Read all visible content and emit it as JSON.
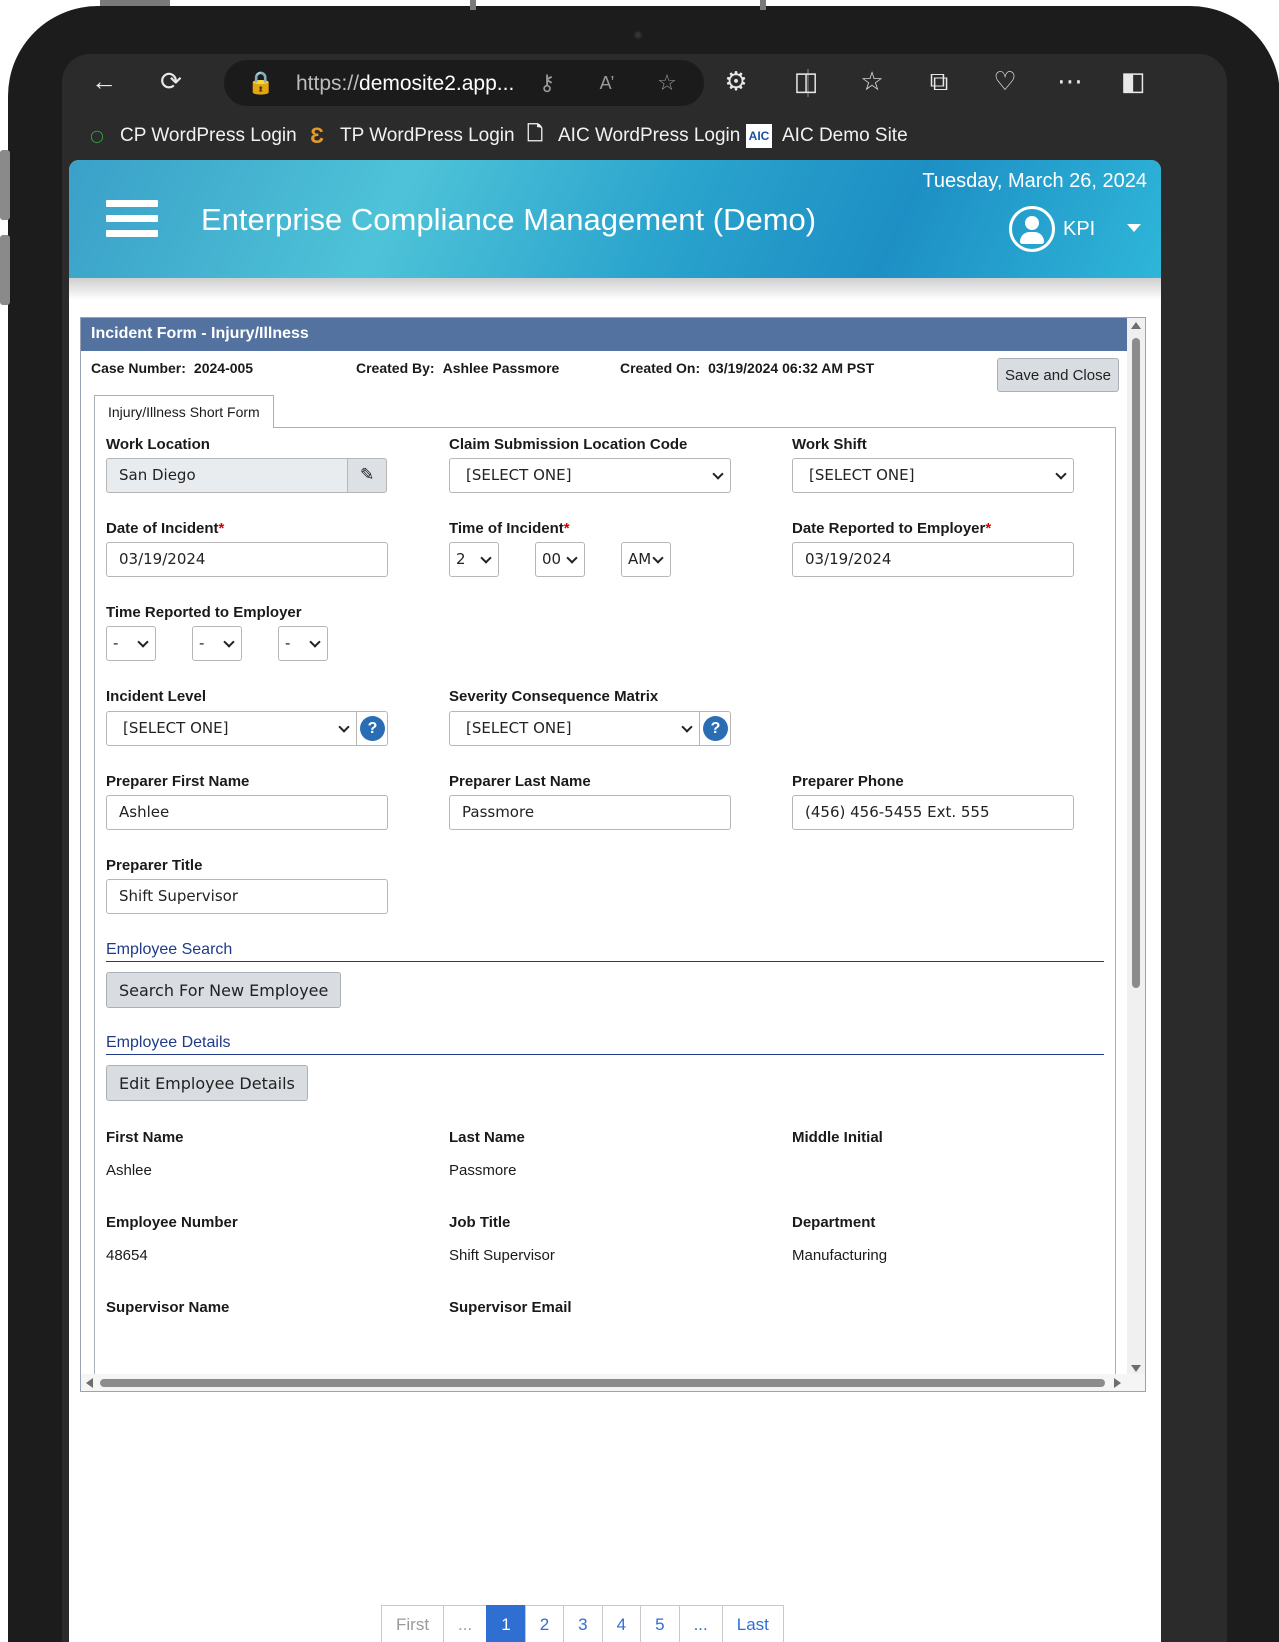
{
  "browser": {
    "url_prefix": "https://",
    "url_host": "demosite2.app...",
    "bookmarks": [
      {
        "label": "CP WordPress Login"
      },
      {
        "label": "TP WordPress Login"
      },
      {
        "label": "AIC WordPress Login"
      },
      {
        "label": "AIC Demo Site"
      }
    ]
  },
  "header": {
    "title": "Enterprise Compliance Management (Demo)",
    "date": "Tuesday, March 26, 2024",
    "user": "KPI"
  },
  "form": {
    "title": "Incident Form - Injury/Illness",
    "case_number_label": "Case Number:",
    "case_number": "2024-005",
    "created_by_label": "Created By:",
    "created_by": "Ashlee Passmore",
    "created_on_label": "Created On:",
    "created_on": "03/19/2024 06:32 AM PST",
    "save_close": "Save and Close",
    "tab": "Injury/Illness Short Form",
    "fields": {
      "work_location_label": "Work Location",
      "work_location": "San Diego",
      "claim_code_label": "Claim Submission Location Code",
      "claim_code": "[SELECT ONE]",
      "work_shift_label": "Work Shift",
      "work_shift": "[SELECT ONE]",
      "date_incident_label": "Date of Incident",
      "date_incident": "03/19/2024",
      "time_incident_label": "Time of Incident",
      "time_hour": "2",
      "time_min": "00",
      "time_ampm": "AM",
      "date_reported_label": "Date Reported to Employer",
      "date_reported": "03/19/2024",
      "time_reported_label": "Time Reported to Employer",
      "time_rep_hour": "-",
      "time_rep_min": "-",
      "time_rep_ampm": "-",
      "incident_level_label": "Incident Level",
      "incident_level": "[SELECT ONE]",
      "severity_label": "Severity Consequence Matrix",
      "severity": "[SELECT ONE]",
      "help_glyph": "?",
      "prep_first_label": "Preparer First Name",
      "prep_first": "Ashlee",
      "prep_last_label": "Preparer Last Name",
      "prep_last": "Passmore",
      "prep_phone_label": "Preparer Phone",
      "prep_phone": "(456) 456-5455 Ext. 555",
      "prep_title_label": "Preparer Title",
      "prep_title": "Shift Supervisor",
      "required_mark": "*"
    },
    "employee_search": {
      "heading": "Employee Search",
      "button": "Search For New Employee"
    },
    "employee_details": {
      "heading": "Employee Details",
      "button": "Edit Employee Details",
      "first_name_label": "First Name",
      "first_name": "Ashlee",
      "last_name_label": "Last Name",
      "last_name": "Passmore",
      "middle_initial_label": "Middle Initial",
      "middle_initial": "",
      "emp_number_label": "Employee Number",
      "emp_number": "48654",
      "job_title_label": "Job Title",
      "job_title": "Shift Supervisor",
      "department_label": "Department",
      "department": "Manufacturing",
      "supervisor_name_label": "Supervisor Name",
      "supervisor_email_label": "Supervisor Email"
    }
  },
  "pager": {
    "first": "First",
    "prev": "...",
    "pages": [
      "1",
      "2",
      "3",
      "4",
      "5"
    ],
    "next": "...",
    "last": "Last"
  }
}
